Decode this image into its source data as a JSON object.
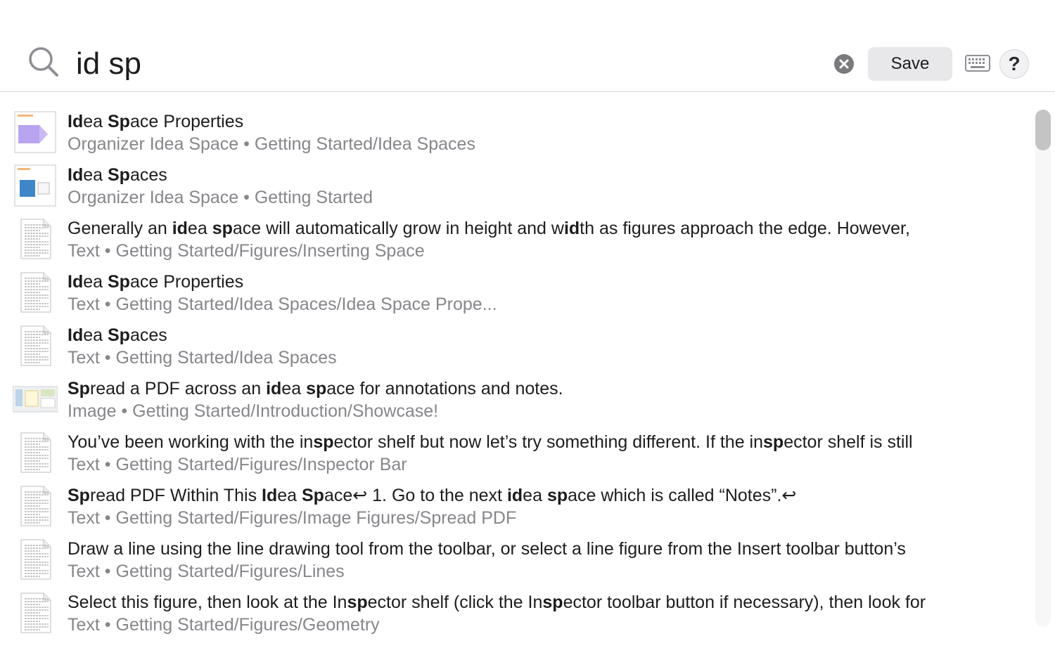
{
  "search": {
    "query": "id sp",
    "placeholder": ""
  },
  "toolbar": {
    "save_label": "Save",
    "help_label": "?"
  },
  "separator": "•",
  "results": [
    {
      "thumb": "doc-purple",
      "title": [
        [
          "Id",
          1
        ],
        [
          "ea ",
          0
        ],
        [
          "Sp",
          1
        ],
        [
          "ace Properties",
          0
        ]
      ],
      "kind": "Organizer Idea Space",
      "path": "Getting Started/Idea Spaces"
    },
    {
      "thumb": "doc-blue",
      "title": [
        [
          "Id",
          1
        ],
        [
          "ea ",
          0
        ],
        [
          "Sp",
          1
        ],
        [
          "aces",
          0
        ]
      ],
      "kind": "Organizer Idea Space",
      "path": "Getting Started"
    },
    {
      "thumb": "text",
      "title": [
        [
          "Generally an ",
          0
        ],
        [
          "id",
          1
        ],
        [
          "ea ",
          0
        ],
        [
          "sp",
          1
        ],
        [
          "ace will automatically grow in height and w",
          0
        ],
        [
          "id",
          1
        ],
        [
          "th as figures approach the edge. However,",
          0
        ]
      ],
      "kind": "Text",
      "path": "Getting Started/Figures/Inserting Space"
    },
    {
      "thumb": "text",
      "title": [
        [
          "Id",
          1
        ],
        [
          "ea ",
          0
        ],
        [
          "Sp",
          1
        ],
        [
          "ace Properties",
          0
        ]
      ],
      "kind": "Text",
      "path": "Getting Started/Idea Spaces/Idea Space Prope..."
    },
    {
      "thumb": "text",
      "title": [
        [
          "Id",
          1
        ],
        [
          "ea ",
          0
        ],
        [
          "Sp",
          1
        ],
        [
          "aces",
          0
        ]
      ],
      "kind": "Text",
      "path": "Getting Started/Idea Spaces"
    },
    {
      "thumb": "image",
      "title": [
        [
          "Sp",
          1
        ],
        [
          "read a PDF across an ",
          0
        ],
        [
          "id",
          1
        ],
        [
          "ea ",
          0
        ],
        [
          "sp",
          1
        ],
        [
          "ace for annotations and notes.",
          0
        ]
      ],
      "kind": "Image",
      "path": "Getting Started/Introduction/Showcase!"
    },
    {
      "thumb": "text",
      "title": [
        [
          "You’ve been working with the in",
          0
        ],
        [
          "sp",
          1
        ],
        [
          "ector shelf but now let’s try something different. If the in",
          0
        ],
        [
          "sp",
          1
        ],
        [
          "ector shelf is still",
          0
        ]
      ],
      "kind": "Text",
      "path": "Getting Started/Figures/Inspector Bar"
    },
    {
      "thumb": "text",
      "title": [
        [
          "Sp",
          1
        ],
        [
          "read PDF Within This ",
          0
        ],
        [
          "Id",
          1
        ],
        [
          "ea ",
          0
        ],
        [
          "Sp",
          1
        ],
        [
          "ace↩      1.      Go to the next ",
          0
        ],
        [
          "id",
          1
        ],
        [
          "ea ",
          0
        ],
        [
          "sp",
          1
        ],
        [
          "ace which is called “Notes”.↩",
          0
        ]
      ],
      "kind": "Text",
      "path": "Getting Started/Figures/Image Figures/Spread PDF"
    },
    {
      "thumb": "text",
      "title": [
        [
          "Draw a line using the line drawing tool from the toolbar, or select a line figure from the Insert toolbar button’s",
          0
        ]
      ],
      "kind": "Text",
      "path": "Getting Started/Figures/Lines"
    },
    {
      "thumb": "text",
      "title": [
        [
          "Select this figure, then look at the In",
          0
        ],
        [
          "sp",
          1
        ],
        [
          "ector shelf (click the In",
          0
        ],
        [
          "sp",
          1
        ],
        [
          "ector toolbar button if necessary), then look for",
          0
        ]
      ],
      "kind": "Text",
      "path": "Getting Started/Figures/Geometry"
    }
  ],
  "icons": {
    "search": "magnifier-icon",
    "clear": "clear-circle-icon",
    "keyboard": "keyboard-icon",
    "help": "help-icon"
  },
  "colors": {
    "muted_text": "#86868b",
    "primary_text": "#1d1d1f",
    "clear_button": "#7b7b7d"
  }
}
